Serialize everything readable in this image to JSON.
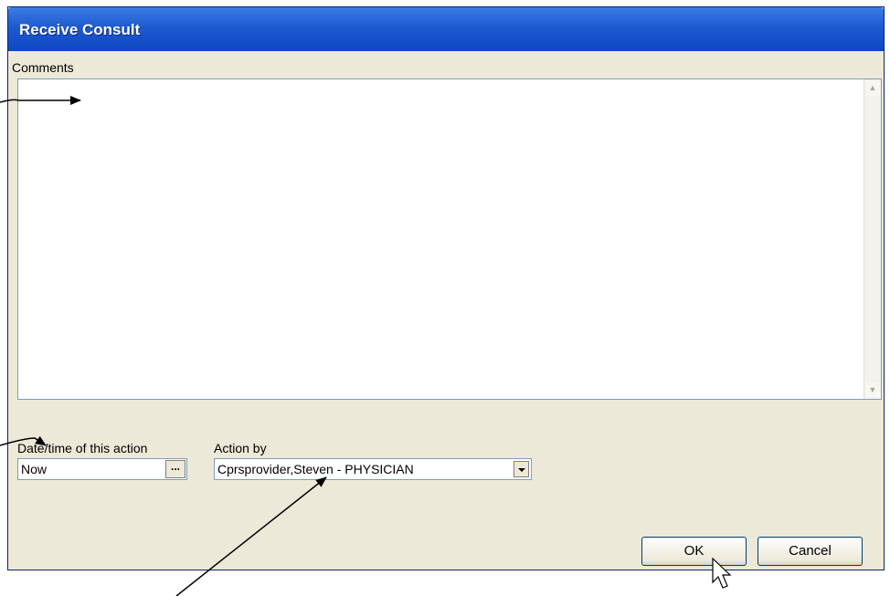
{
  "dialog": {
    "title": "Receive Consult",
    "comments_label": "Comments",
    "comments_value": "",
    "datetime_label": "Date/time of this action",
    "datetime_value": "Now",
    "datetime_picker_label": "...",
    "action_by_label": "Action by",
    "action_by_value": "Cprsprovider,Steven - PHYSICIAN",
    "ok_label": "OK",
    "cancel_label": "Cancel"
  },
  "icons": {
    "scroll_up": "chevron-up-icon",
    "scroll_down": "chevron-down-icon",
    "dropdown": "dropdown-arrow-icon",
    "cursor": "mouse-pointer-icon"
  },
  "colors": {
    "titlebar": "#1e5bd0",
    "window_bg": "#ece9d8",
    "field_border": "#7f9db9"
  }
}
